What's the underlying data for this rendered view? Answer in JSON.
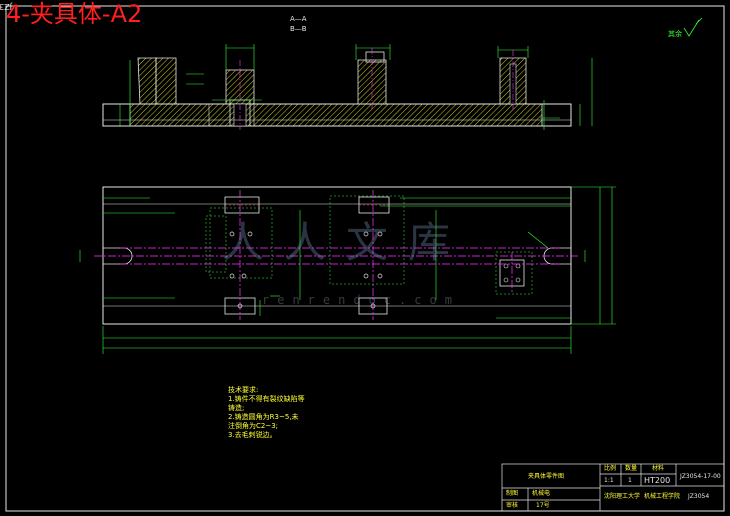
{
  "sheet_title": "4-夹具体-A2",
  "corner_code": "JZ3054-00",
  "section_labels": [
    "A—A",
    "B—B"
  ],
  "roughness_note": "其余",
  "tech_requirements": {
    "title": "技术要求:",
    "lines": [
      "1.铸件不得有裂纹缺陷等",
      "铸造;",
      "2.铸造圆角为R3~5,未",
      "注倒角为C2~3;",
      "3.去毛刺锐边。"
    ]
  },
  "title_block": {
    "part_name": "夹具体零件图",
    "material": "HT200",
    "drawing_no": "JZ3054-17-00",
    "scale": "1:1",
    "quantity": "1",
    "headers": [
      "比例",
      "数量",
      "材料"
    ],
    "school": "沈阳理工大学",
    "dept": "机械工程学院",
    "project": "JZ3054",
    "roles": [
      "制图",
      "审核"
    ],
    "role_values": [
      "机械电",
      "17号"
    ]
  },
  "watermark": {
    "main": "人人文库",
    "sub": "renrendoc.com"
  },
  "colors": {
    "outline": "#e6e6e6",
    "dimension": "#33ff33",
    "center_line": "#ff33ff",
    "hatch": "#ffff33",
    "title": "#ff1f1f",
    "hidden": "#ff4040"
  }
}
